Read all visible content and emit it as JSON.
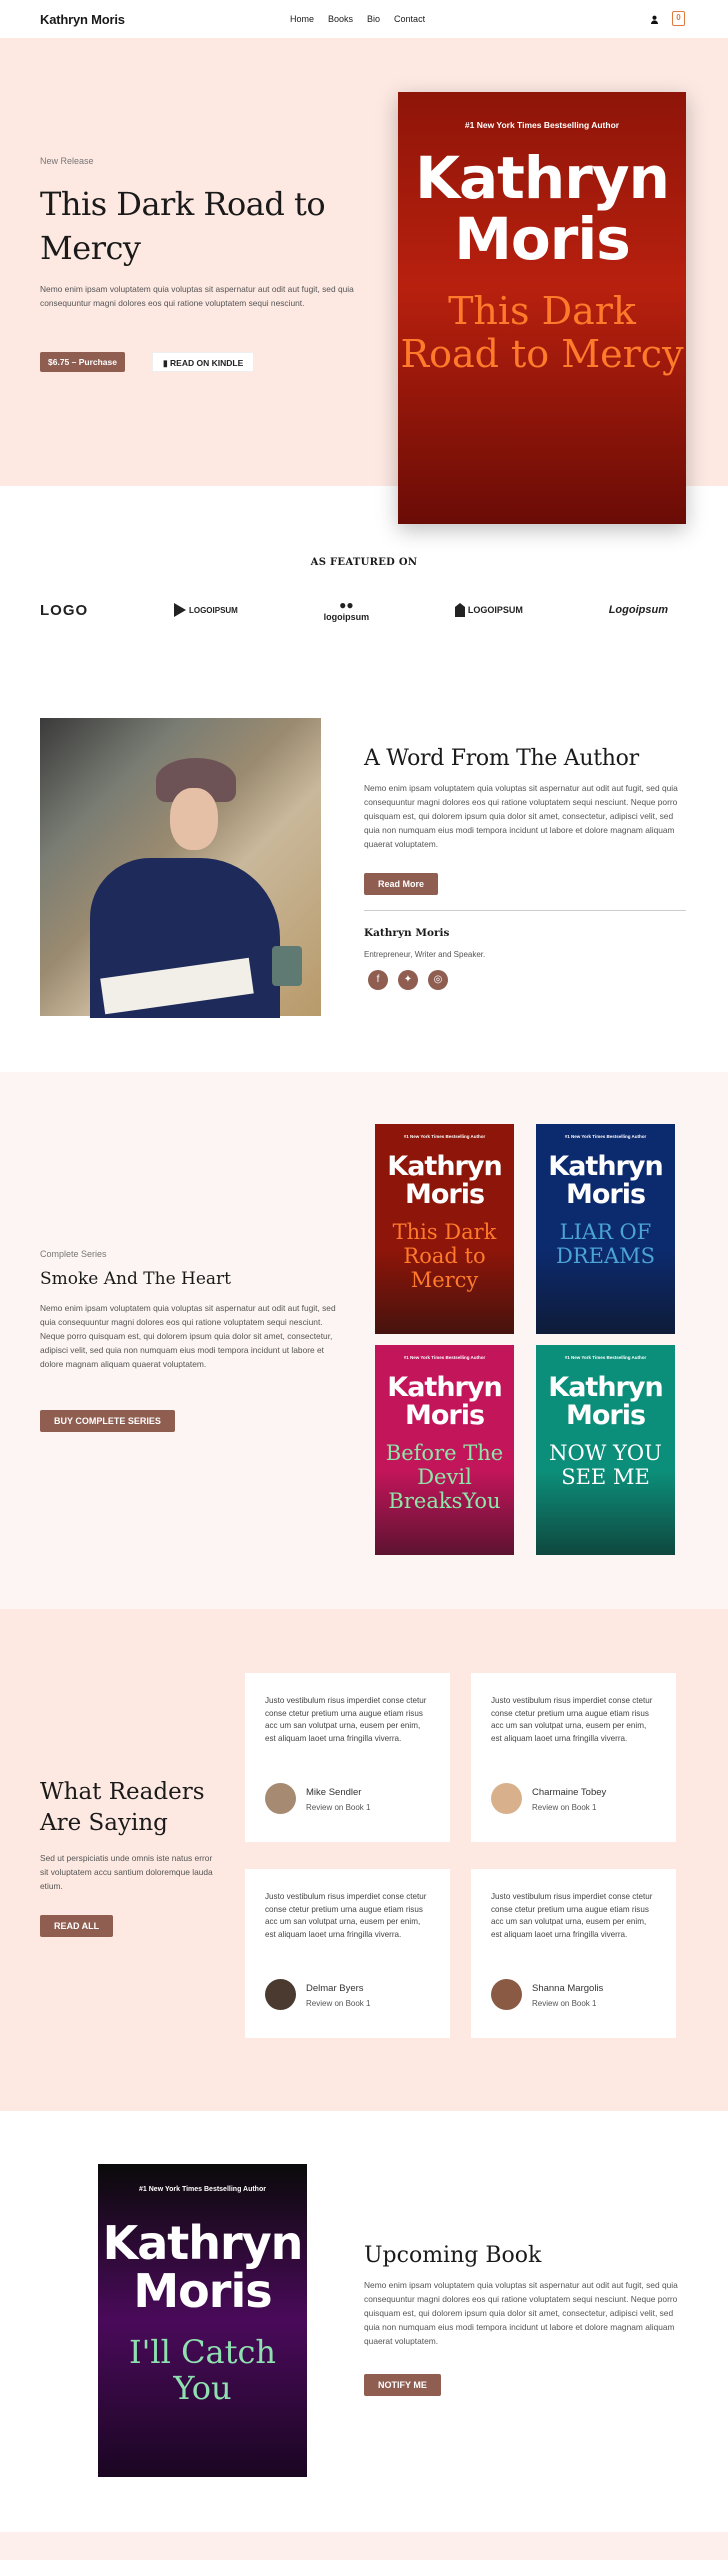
{
  "header": {
    "logo": "Kathryn Moris",
    "nav": [
      "Home",
      "Books",
      "Bio",
      "Contact"
    ],
    "cart_count": "0"
  },
  "hero": {
    "subtitle": "New Release",
    "title": "This Dark Road to Mercy",
    "text": "Nemo enim ipsam voluptatem quia voluptas sit aspernatur aut odit aut fugit, sed quia consequuntur magni dolores eos qui ratione voluptatem sequi nesciunt.",
    "price_button": "$6.75 – Purchase",
    "kindle_button": "READ ON KINDLE",
    "book": {
      "tag": "#1 New York Times Bestselling Author",
      "author": "Kathryn Moris",
      "title": "This Dark Road to Mercy"
    }
  },
  "featured": {
    "title": "AS FEATURED ON",
    "logos": [
      "LOGO",
      "LOGOIPSUM",
      "logoipsum",
      "LOGOIPSUM",
      "Logoipsum"
    ]
  },
  "author_section": {
    "title": "A Word From The Author",
    "text": "Nemo enim ipsam voluptatem quia voluptas sit aspernatur aut odit aut fugit, sed quia consequuntur magni dolores eos qui ratione voluptatem sequi nesciunt. Neque porro quisquam est, qui dolorem ipsum quia dolor sit amet, consectetur, adipisci velit, sed quia non numquam eius modi tempora incidunt ut labore et dolore magnam aliquam quaerat voluptatem.",
    "button": "Read More",
    "name": "Kathryn Moris",
    "role": "Entrepreneur, Writer and Speaker.",
    "social": [
      "facebook",
      "twitter",
      "instagram"
    ]
  },
  "series": {
    "subtitle": "Complete Series",
    "title": "Smoke And The Heart",
    "text": "Nemo enim ipsam voluptatem quia voluptas sit aspernatur aut odit aut fugit, sed quia consequuntur magni dolores eos qui ratione voluptatem sequi nesciunt. Neque porro quisquam est, qui dolorem ipsum quia dolor sit amet, consectetur, adipisci velit, sed quia non numquam eius modi tempora incidunt ut labore et dolore magnam aliquam quaerat voluptatem.",
    "button": "BUY COMPLETE SERIES",
    "books": [
      {
        "tag": "#1 New York Times Bestselling Author",
        "author": "Kathryn Moris",
        "title": "This Dark Road to Mercy",
        "bg": "#8e1509",
        "title_color": "#ff7a2a"
      },
      {
        "tag": "#1 New York Times Bestselling Author",
        "author": "Kathryn Moris",
        "title": "LIAR OF DREAMS",
        "bg": "#0c2a6e",
        "title_color": "#4ba3d6"
      },
      {
        "tag": "#1 New York Times Bestselling Author",
        "author": "Kathryn Moris",
        "title": "Before The Devil BreaksYou",
        "bg": "#c2155a",
        "title_color": "#8ee6a8"
      },
      {
        "tag": "#1 New York Times Bestselling Author",
        "author": "Kathryn Moris",
        "title": "NOW YOU SEE ME",
        "bg": "#0c8f7a",
        "title_color": "#ffffff"
      }
    ]
  },
  "readers": {
    "title": "What Readers Are Saying",
    "text": "Sed ut perspiciatis unde omnis iste natus error sit voluptatem accu santium doloremque lauda etium.",
    "button": "READ ALL",
    "reviews": [
      {
        "quote": "Justo vestibulum risus imperdiet conse ctetur conse ctetur pretium urna augue etiam risus acc um san volutpat urna, eusem per enim, est aliquam laoet urna fringilla viverra.",
        "name": "Mike Sendler",
        "book": "Review on Book 1"
      },
      {
        "quote": "Justo vestibulum risus imperdiet conse ctetur conse ctetur pretium urna augue etiam risus acc um san volutpat urna, eusem per enim, est aliquam laoet urna fringilla viverra.",
        "name": "Charmaine Tobey",
        "book": "Review on Book 1"
      },
      {
        "quote": "Justo vestibulum risus imperdiet conse ctetur conse ctetur pretium urna augue etiam risus acc um san volutpat urna, eusem per enim, est aliquam laoet urna fringilla viverra.",
        "name": "Delmar Byers",
        "book": "Review on Book 1"
      },
      {
        "quote": "Justo vestibulum risus imperdiet conse ctetur conse ctetur pretium urna augue etiam risus acc um san volutpat urna, eusem per enim, est aliquam laoet urna fringilla viverra.",
        "name": "Shanna Margolis",
        "book": "Review on Book 1"
      }
    ]
  },
  "upcoming": {
    "title": "Upcoming Book",
    "text": "Nemo enim ipsam voluptatem quia voluptas sit aspernatur aut odit aut fugit, sed quia consequuntur magni dolores eos qui ratione voluptatem sequi nesciunt. Neque porro quisquam est, qui dolorem ipsum quia dolor sit amet, consectetur, adipisci velit, sed quia non numquam eius modi tempora incidunt ut labore et dolore magnam aliquam quaerat voluptatem.",
    "button": "NOTIFY ME",
    "book": {
      "tag": "#1 New York Times Bestselling Author",
      "author": "Kathryn Moris",
      "title": "I'll Catch You"
    }
  }
}
